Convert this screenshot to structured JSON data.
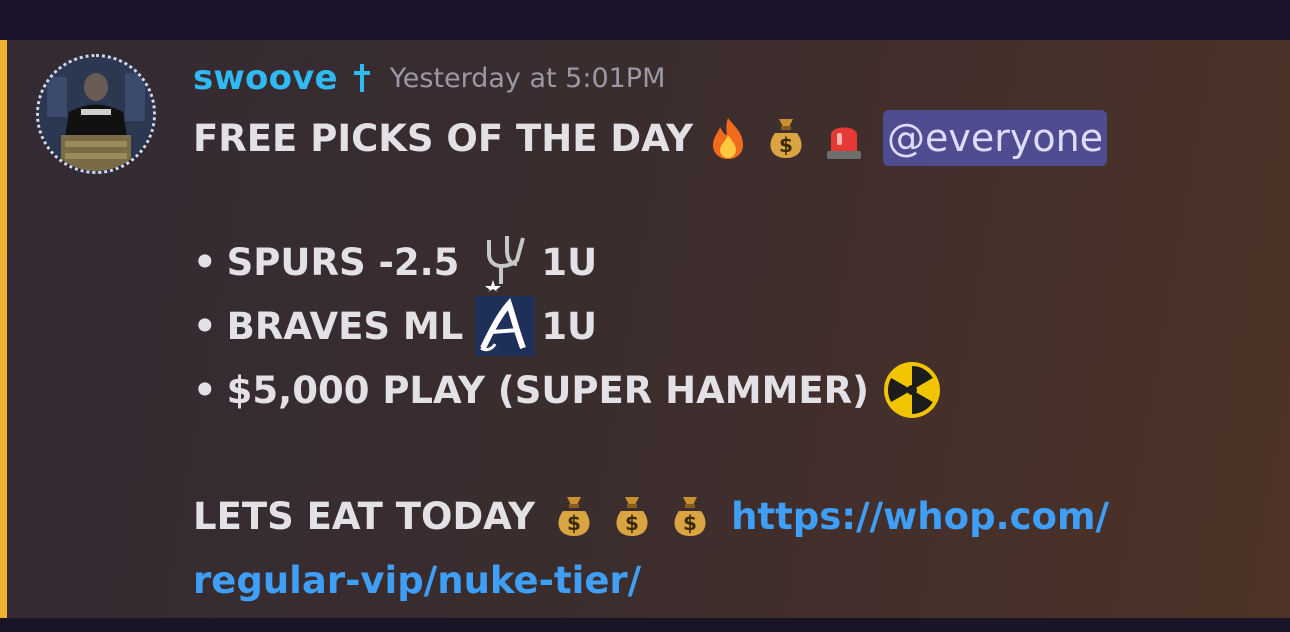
{
  "message": {
    "author": {
      "username": "swoove",
      "badge_icon": "cross-icon",
      "avatar_icon": "avatar"
    },
    "timestamp": "Yesterday at 5:01PM",
    "headline": "FREE PICKS OF THE DAY",
    "headline_emojis": [
      "fire-emoji",
      "money-bag-emoji",
      "police-light-emoji"
    ],
    "mention": "@everyone",
    "picks": [
      {
        "bullet": "•",
        "text": "SPURS -2.5",
        "logo": "spurs-logo",
        "units": "1U"
      },
      {
        "bullet": "•",
        "text": "BRAVES ML",
        "logo": "braves-logo",
        "units": "1U"
      },
      {
        "bullet": "•",
        "text": "$5,000 PLAY (SUPER HAMMER)",
        "emoji": "radioactive-emoji"
      }
    ],
    "closing_text": "LETS EAT TODAY",
    "closing_emojis": [
      "money-bag-emoji",
      "money-bag-emoji",
      "money-bag-emoji"
    ],
    "link_line1": "https://whop.com/",
    "link_line2": "regular-vip/nuke-tier/"
  },
  "colors": {
    "username": "#2fbaf2",
    "accent_bar": "#f0b232",
    "mention_bg": "#4f4d8f",
    "link": "#3f9ff7"
  }
}
